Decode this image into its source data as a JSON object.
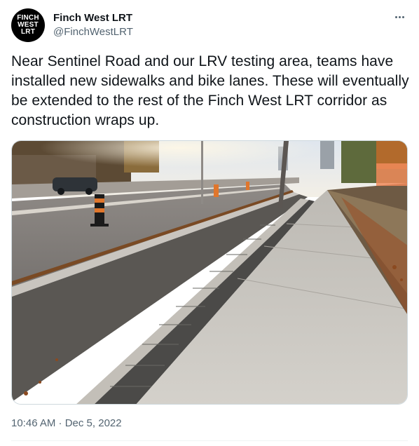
{
  "account": {
    "avatar_lines": [
      "FINCH",
      "WEST",
      "LRT"
    ],
    "display_name": "Finch West LRT",
    "handle": "@FinchWestLRT"
  },
  "tweet": {
    "text": "Near Sentinel Road and our LRV testing area, teams have installed new sidewalks and bike lanes. These will eventually be extended to the rest of the Finch West LRT corridor as construction wraps up.",
    "timestamp": "10:46 AM · Dec 5, 2022"
  },
  "icons": {
    "more": "more-horizontal-icon"
  },
  "colors": {
    "text": "#0f1419",
    "secondary": "#536471",
    "avatar_bg": "#000000"
  }
}
